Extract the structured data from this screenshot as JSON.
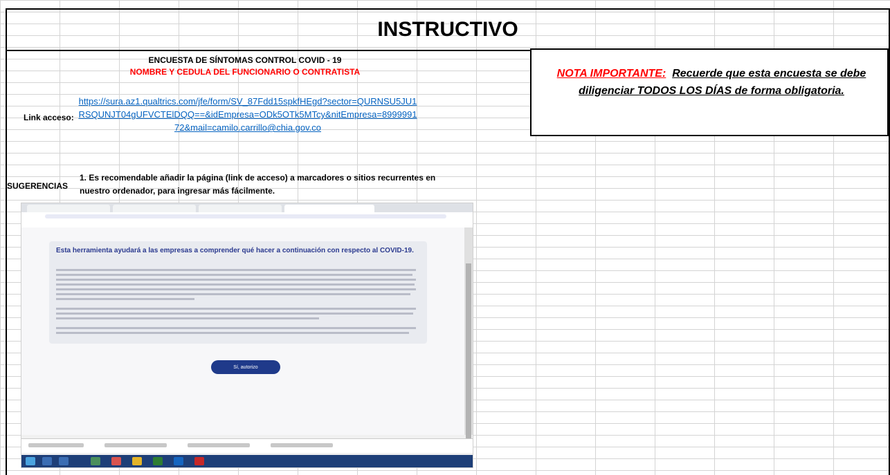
{
  "sheet": {
    "title": "INSTRUCTIVO",
    "survey_title": "ENCUESTA DE SÍNTOMAS CONTROL COVID - 19",
    "survey_subtitle": "NOMBRE Y CEDULA DEL FUNCIONARIO O CONTRATISTA",
    "link_label": "Link acceso:",
    "link_url": "https://sura.az1.qualtrics.com/jfe/form/SV_87Fdd15spkfHEgd?sector=QURNSU5JU1RSQUNJT04gUFVCTElDQQ==&idEmpresa=ODk5OTk5MTcy&nitEmpresa=899999172&mail=camilo.carrillo@chia.gov.co",
    "note_red": "NOTA IMPORTANTE:",
    "note_black": "Recuerde que esta encuesta se debe diligenciar TODOS LOS DÍAS de forma obligatoria.",
    "suggestions_label": "SUGERENCIAS",
    "suggestion_1": "1. Es recomendable añadir la página (link de acceso) a marcadores o sitios recurrentes en nuestro ordenador, para ingresar más fácilmente."
  },
  "screenshot": {
    "heading": "Esta herramienta ayudará a las empresas a comprender qué hacer a continuación con respecto al COVID-19.",
    "button_label": "Sí, autorizo"
  },
  "colors": {
    "link": "#0563c1",
    "red": "#ff0000",
    "grid": "#d4d4d4",
    "taskbar": "#1e3f78",
    "accent_button": "#1f3a8a"
  }
}
